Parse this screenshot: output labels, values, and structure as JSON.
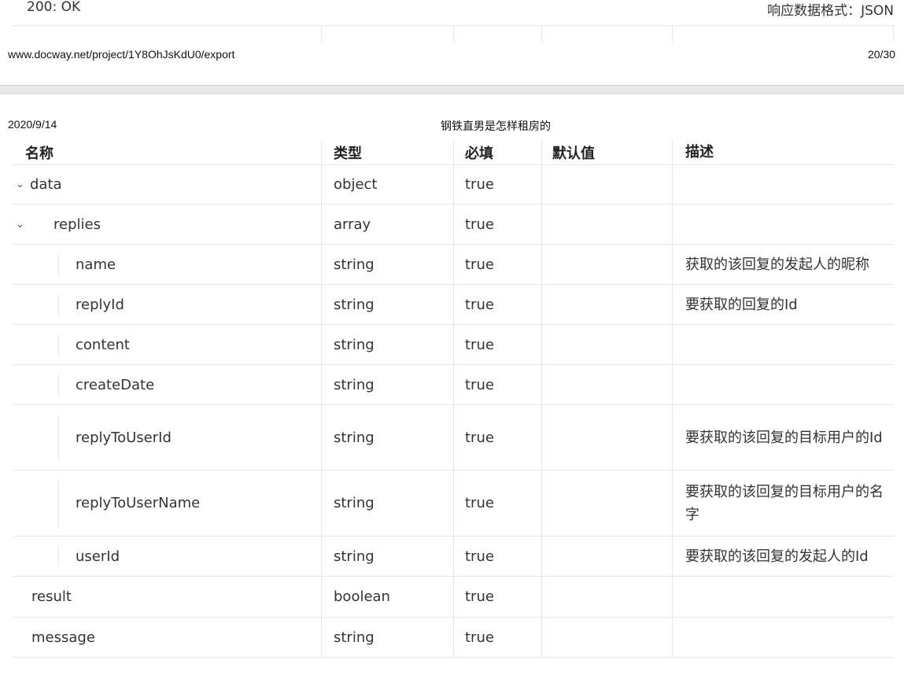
{
  "top": {
    "status": "200: OK",
    "response_format": "响应数据格式：JSON"
  },
  "footer": {
    "url": "www.docway.net/project/1Y8OhJsKdU0/export",
    "page": "20/30"
  },
  "header": {
    "date": "2020/9/14",
    "title": "钢铁直男是怎样租房的"
  },
  "table": {
    "columns": [
      "名称",
      "类型",
      "必填",
      "默认值",
      "描述"
    ],
    "rows": [
      {
        "name": "data",
        "type": "object",
        "required": "true",
        "default": "",
        "desc": ""
      },
      {
        "name": "replies",
        "type": "array",
        "required": "true",
        "default": "",
        "desc": ""
      },
      {
        "name": "name",
        "type": "string",
        "required": "true",
        "default": "",
        "desc": "获取的该回复的发起人的昵称"
      },
      {
        "name": "replyId",
        "type": "string",
        "required": "true",
        "default": "",
        "desc": "要获取的回复的Id"
      },
      {
        "name": "content",
        "type": "string",
        "required": "true",
        "default": "",
        "desc": ""
      },
      {
        "name": "createDate",
        "type": "string",
        "required": "true",
        "default": "",
        "desc": ""
      },
      {
        "name": "replyToUserId",
        "type": "string",
        "required": "true",
        "default": "",
        "desc": "要获取的该回复的目标用户的Id"
      },
      {
        "name": "replyToUserName",
        "type": "string",
        "required": "true",
        "default": "",
        "desc": "要获取的该回复的目标用户的名字"
      },
      {
        "name": "userId",
        "type": "string",
        "required": "true",
        "default": "",
        "desc": "要获取的该回复的发起人的Id"
      },
      {
        "name": "result",
        "type": "boolean",
        "required": "true",
        "default": "",
        "desc": ""
      },
      {
        "name": "message",
        "type": "string",
        "required": "true",
        "default": "",
        "desc": ""
      }
    ]
  }
}
